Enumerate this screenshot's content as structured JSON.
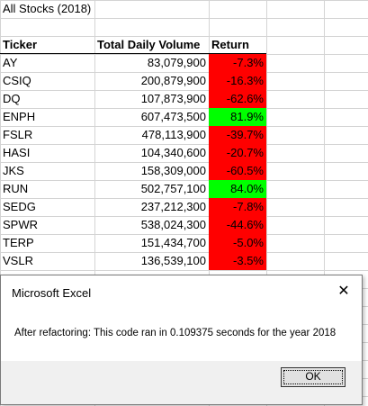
{
  "sheet": {
    "title": "All Stocks (2018)",
    "headers": {
      "ticker": "Ticker",
      "volume": "Total Daily Volume",
      "return": "Return"
    },
    "rows": [
      {
        "ticker": "AY",
        "volume": "83,079,900",
        "return": "-7.3%",
        "status": "negative"
      },
      {
        "ticker": "CSIQ",
        "volume": "200,879,900",
        "return": "-16.3%",
        "status": "negative"
      },
      {
        "ticker": "DQ",
        "volume": "107,873,900",
        "return": "-62.6%",
        "status": "negative"
      },
      {
        "ticker": "ENPH",
        "volume": "607,473,500",
        "return": "81.9%",
        "status": "positive"
      },
      {
        "ticker": "FSLR",
        "volume": "478,113,900",
        "return": "-39.7%",
        "status": "negative"
      },
      {
        "ticker": "HASI",
        "volume": "104,340,600",
        "return": "-20.7%",
        "status": "negative"
      },
      {
        "ticker": "JKS",
        "volume": "158,309,000",
        "return": "-60.5%",
        "status": "negative"
      },
      {
        "ticker": "RUN",
        "volume": "502,757,100",
        "return": "84.0%",
        "status": "positive"
      },
      {
        "ticker": "SEDG",
        "volume": "237,212,300",
        "return": "-7.8%",
        "status": "negative"
      },
      {
        "ticker": "SPWR",
        "volume": "538,024,300",
        "return": "-44.6%",
        "status": "negative"
      },
      {
        "ticker": "TERP",
        "volume": "151,434,700",
        "return": "-5.0%",
        "status": "negative"
      },
      {
        "ticker": "VSLR",
        "volume": "136,539,100",
        "return": "-3.5%",
        "status": "negative"
      }
    ],
    "colors": {
      "negative": "#ff0000",
      "positive": "#00ff00"
    }
  },
  "dialog": {
    "title": "Microsoft Excel",
    "close_icon": "close-icon",
    "message": "After refactoring: This code ran in 0.109375 seconds for the year 2018",
    "ok_label": "OK"
  }
}
